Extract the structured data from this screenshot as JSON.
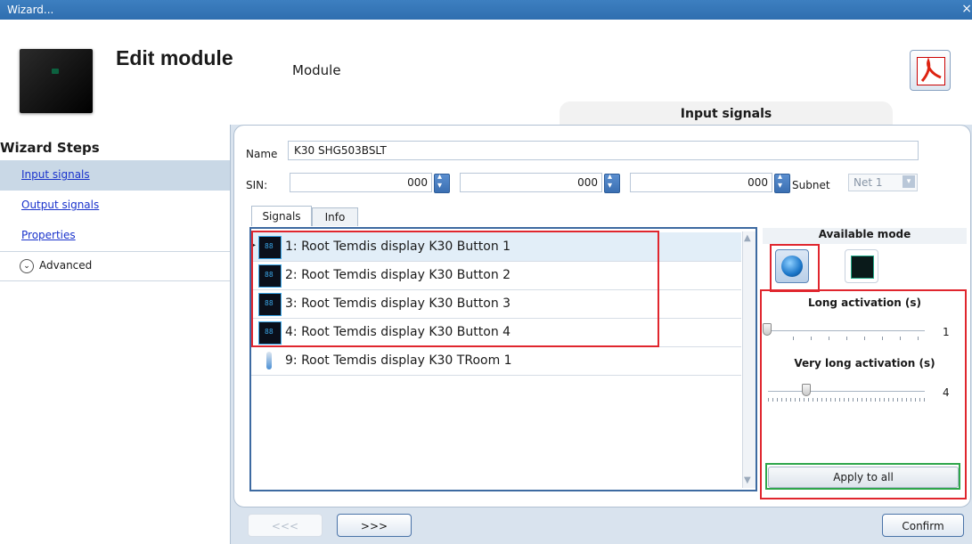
{
  "window": {
    "title": "Wizard...",
    "close_glyph": "×"
  },
  "header": {
    "title": "Edit module",
    "subtitle": "Module",
    "pdf_icon": "pdf-report-icon",
    "active_section": "Input signals"
  },
  "wizard": {
    "title": "Wizard Steps",
    "steps": [
      "Input signals",
      "Output signals",
      "Properties"
    ],
    "advanced_label": "Advanced"
  },
  "form": {
    "name_label": "Name",
    "name_value": "K30 SHG503BSLT",
    "sin_label": "SIN:",
    "sin_values": [
      "000",
      "000",
      "000"
    ],
    "subnet_label": "Subnet",
    "subnet_value": "Net 1"
  },
  "tabs": [
    "Signals",
    "Info"
  ],
  "signals": [
    {
      "label": "1: Root Temdis display K30 Button 1",
      "icon": "display-button-icon"
    },
    {
      "label": "2: Root Temdis display K30 Button 2",
      "icon": "display-button-icon"
    },
    {
      "label": "3: Root Temdis display K30 Button 3",
      "icon": "display-button-icon"
    },
    {
      "label": "4: Root Temdis display K30 Button 4",
      "icon": "display-button-icon"
    },
    {
      "label": "9: Root Temdis display K30 TRoom 1",
      "icon": "thermometer-icon"
    }
  ],
  "mode": {
    "title": "Available mode",
    "long_label": "Long activation (s)",
    "long_value": "1",
    "very_long_label": "Very long activation (s)",
    "very_long_value": "4",
    "apply_label": "Apply to all"
  },
  "nav": {
    "prev": "<<<",
    "next": ">>>",
    "confirm": "Confirm"
  },
  "colors": {
    "titlebar": "#2f6eaf",
    "highlight_red": "#e0262e",
    "highlight_green": "#2fa64b"
  }
}
